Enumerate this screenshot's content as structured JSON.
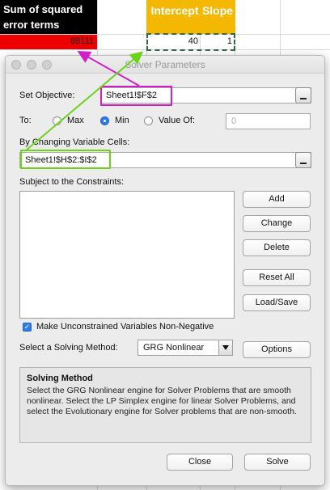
{
  "spreadsheet": {
    "header_black": "Sum of squared error terms",
    "header_intercept": "Intercept",
    "header_slope": "Slope",
    "red_value": "88111",
    "intercept_value": "40",
    "slope_value": "1"
  },
  "dialog": {
    "title": "Solver Parameters",
    "set_objective_label": "Set Objective:",
    "objective_value": "Sheet1!$F$2",
    "to_label": "To:",
    "radio_max": "Max",
    "radio_min": "Min",
    "radio_value_of": "Value Of:",
    "value_of_field": "0",
    "changing_cells_label": "By Changing Variable Cells:",
    "changing_cells_value": "Sheet1!$H$2:$I$2",
    "constraints_label": "Subject to the Constraints:",
    "buttons": {
      "add": "Add",
      "change": "Change",
      "delete": "Delete",
      "reset_all": "Reset All",
      "load_save": "Load/Save",
      "options": "Options",
      "close": "Close",
      "solve": "Solve"
    },
    "nonnegative_label": "Make Unconstrained Variables Non-Negative",
    "nonnegative_checked": true,
    "solving_method_label": "Select a Solving Method:",
    "solving_method_value": "GRG Nonlinear",
    "info_title": "Solving Method",
    "info_text": "Select the GRG Nonlinear engine for Solver Problems that are smooth nonlinear. Select the LP Simplex engine for linear Solver Problems, and select the Evolutionary engine for Solver problems that are non-smooth."
  },
  "colors": {
    "annotation_magenta": "#d11fc9",
    "annotation_green": "#6cd21c",
    "accent_blue": "#2b7bea",
    "header_orange": "#f5b800",
    "highlight_red": "#ee0000"
  }
}
